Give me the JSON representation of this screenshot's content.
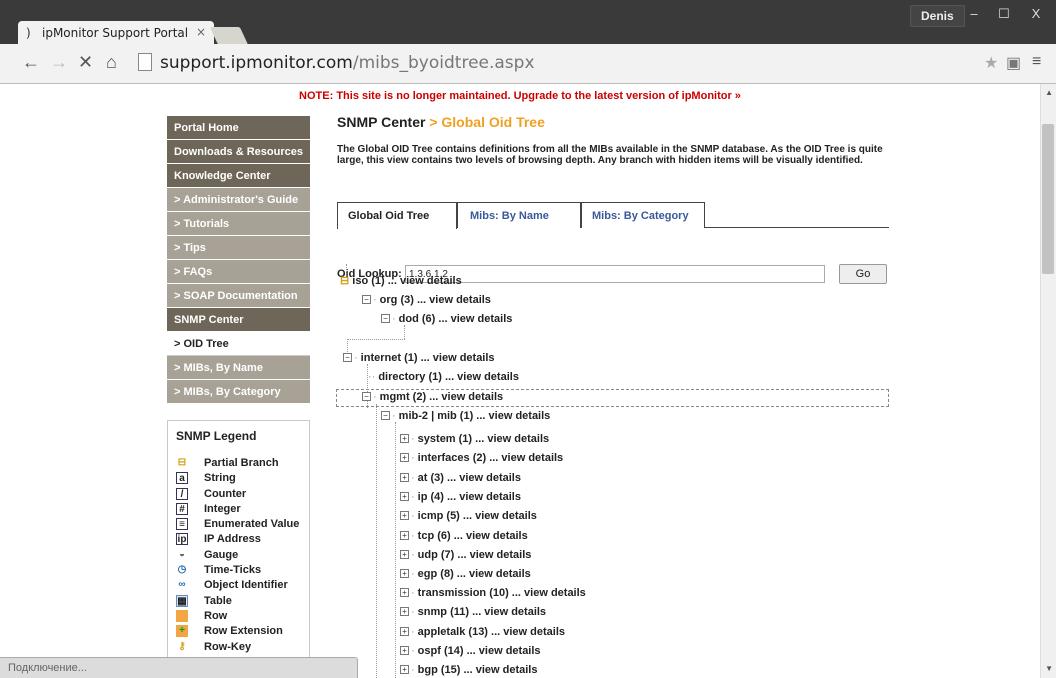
{
  "browser": {
    "tab_title": "ipMonitor Support Portal",
    "tab_close": "×",
    "user_name": "Denis",
    "window_controls": [
      "‒",
      "☐",
      "X"
    ],
    "url_host": "support.ipmonitor.com",
    "url_path": "/mibs_byoidtree.aspx",
    "status_text": "Подключение..."
  },
  "page": {
    "notice": "NOTE: This site is no longer maintained. Upgrade to the latest version of ipMonitor »",
    "title": "SNMP Center",
    "title_sep": " > ",
    "title_sub": "Global Oid Tree",
    "description": "The Global OID Tree contains definitions from all the MIBs available in the SNMP database. As the OID Tree is quite large, this view contains two levels of browsing depth. Any branch with hidden items will be visually identified.",
    "tabs": [
      "Global Oid Tree",
      "Mibs: By Name",
      "Mibs: By Category"
    ],
    "lookup_label": "Oid Lookup:",
    "lookup_value": "1.3.6.1.2",
    "go_label": "Go"
  },
  "sidebar": {
    "items": [
      "Portal Home",
      "Downloads & Resources",
      "Knowledge Center",
      "> Administrator's Guide",
      "> Tutorials",
      "> Tips",
      "> FAQs",
      "> SOAP Documentation",
      "SNMP Center",
      "> OID Tree",
      "> MIBs, By Name",
      "> MIBs, By Category"
    ]
  },
  "legend": {
    "title": "SNMP Legend",
    "items": [
      "Partial Branch",
      "String",
      "Counter",
      "Integer",
      "Enumerated Value",
      "IP Address",
      "Gauge",
      "Time-Ticks",
      "Object Identifier",
      "Table",
      "Row",
      "Row Extension",
      "Row-Key"
    ]
  },
  "tree": {
    "iso": "iso (1) ... view details",
    "org": "org (3) ... view details",
    "dod": "dod (6) ... view details",
    "internet": "internet (1) ... view details",
    "directory": "directory (1) ... view details",
    "mgmt": "mgmt (2) ... view details",
    "mib2": "mib-2 | mib (1) ... view details",
    "children": [
      "system (1) ... view details",
      "interfaces (2) ... view details",
      "at (3) ... view details",
      "ip (4) ... view details",
      "icmp (5) ... view details",
      "tcp (6) ... view details",
      "udp (7) ... view details",
      "egp (8) ... view details",
      "transmission (10) ... view details",
      "snmp (11) ... view details",
      "appletalk (13) ... view details",
      "ospf (14) ... view details",
      "bgp (15) ... view details"
    ]
  }
}
